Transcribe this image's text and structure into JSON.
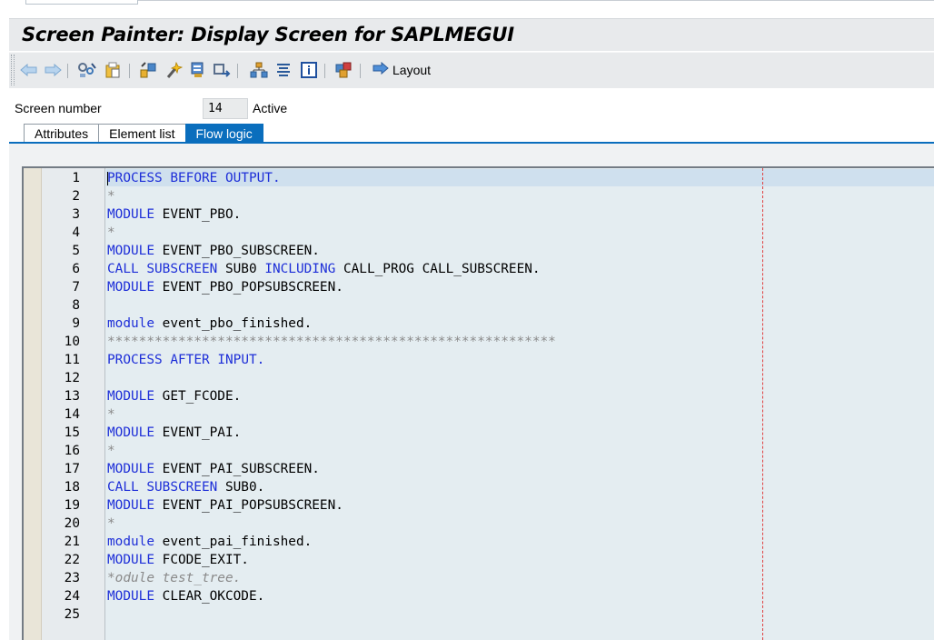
{
  "window": {
    "title": "Screen Painter: Display Screen for SAPLMEGUI"
  },
  "toolbar": {
    "icons": [
      "back-arrow-icon",
      "forward-arrow-icon",
      "other-object-icon",
      "display-change-icon",
      "check-icon",
      "activate-icon",
      "where-used-icon",
      "move-icon",
      "hierarchy-icon",
      "pretty-printer-icon",
      "info-icon",
      "multi-screen-icon",
      "layout-arrow-icon"
    ],
    "layout_label": "Layout"
  },
  "screen": {
    "number_label": "Screen number",
    "number_value": "14",
    "status": "Active"
  },
  "tabs": [
    {
      "label": "Attributes",
      "active": false
    },
    {
      "label": "Element list",
      "active": false
    },
    {
      "label": "Flow logic",
      "active": true
    }
  ],
  "editor": {
    "lines": [
      {
        "n": "1",
        "text": "PROCESS BEFORE OUTPUT."
      },
      {
        "n": "2",
        "text": "*"
      },
      {
        "n": "3",
        "text": "MODULE EVENT_PBO."
      },
      {
        "n": "4",
        "text": "*"
      },
      {
        "n": "5",
        "text": "MODULE EVENT_PBO_SUBSCREEN."
      },
      {
        "n": "6",
        "text": "CALL SUBSCREEN SUB0 INCLUDING CALL_PROG CALL_SUBSCREEN."
      },
      {
        "n": "7",
        "text": "MODULE EVENT_PBO_POPSUBSCREEN."
      },
      {
        "n": "8",
        "text": ""
      },
      {
        "n": "9",
        "text": "module event_pbo_finished."
      },
      {
        "n": "10",
        "text": "*********************************************************"
      },
      {
        "n": "11",
        "text": "PROCESS AFTER INPUT."
      },
      {
        "n": "12",
        "text": ""
      },
      {
        "n": "13",
        "text": "MODULE GET_FCODE."
      },
      {
        "n": "14",
        "text": "*"
      },
      {
        "n": "15",
        "text": "MODULE EVENT_PAI."
      },
      {
        "n": "16",
        "text": "*"
      },
      {
        "n": "17",
        "text": "MODULE EVENT_PAI_SUBSCREEN."
      },
      {
        "n": "18",
        "text": "CALL SUBSCREEN SUB0."
      },
      {
        "n": "19",
        "text": "MODULE EVENT_PAI_POPSUBSCREEN."
      },
      {
        "n": "20",
        "text": "*"
      },
      {
        "n": "21",
        "text": "module event_pai_finished."
      },
      {
        "n": "22",
        "text": "MODULE FCODE_EXIT."
      },
      {
        "n": "23",
        "text": "*odule test_tree."
      },
      {
        "n": "24",
        "text": "MODULE CLEAR_OKCODE."
      },
      {
        "n": "25",
        "text": ""
      }
    ],
    "keywords": [
      "PROCESS",
      "BEFORE",
      "OUTPUT",
      "AFTER",
      "INPUT",
      "MODULE",
      "module",
      "CALL",
      "SUBSCREEN",
      "INCLUDING"
    ],
    "colors": {
      "keyword": "#1e2fd8",
      "comment": "#8a8a8a",
      "current_line": "#cfe0ee",
      "background": "#e4edf1"
    }
  }
}
